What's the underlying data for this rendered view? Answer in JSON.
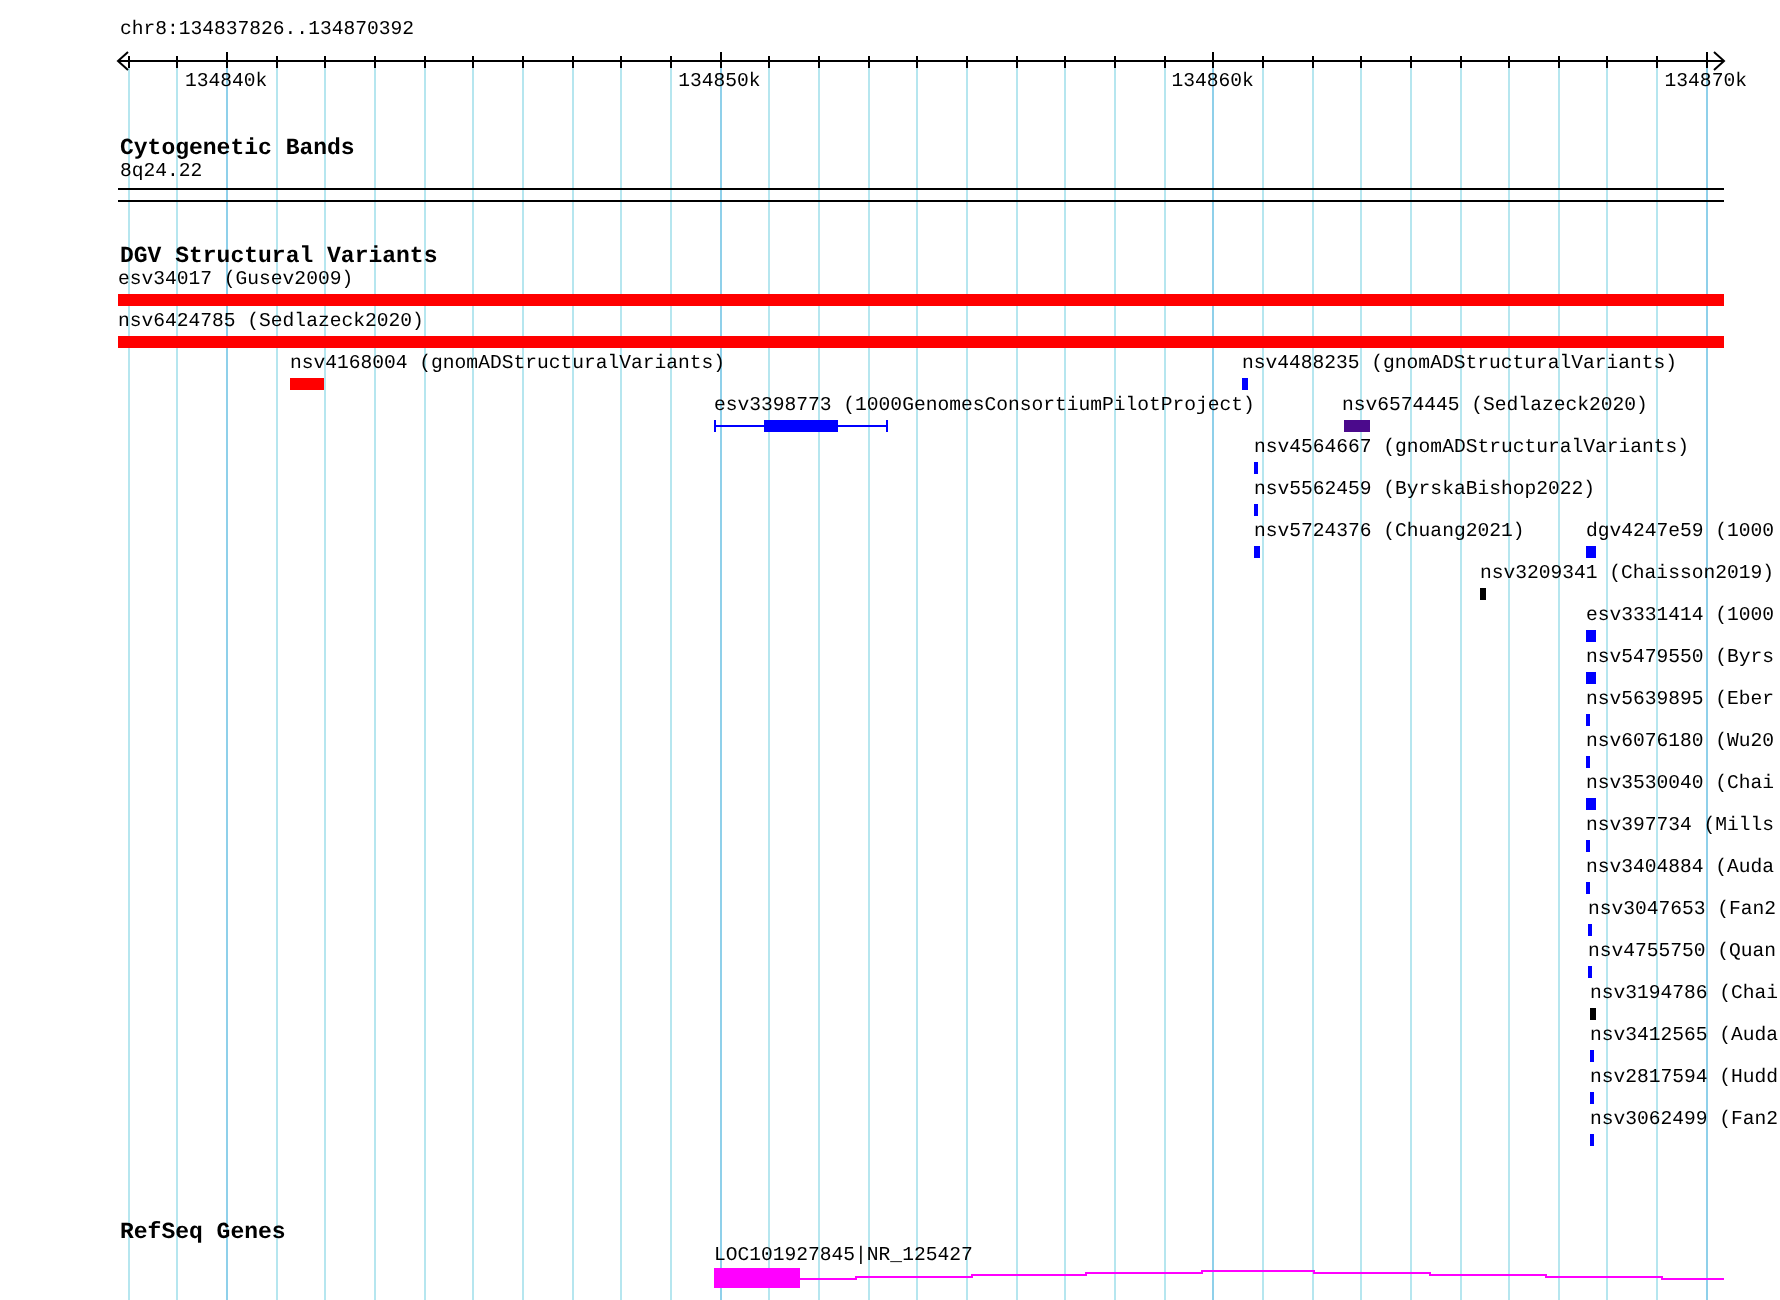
{
  "ruler": {
    "title": "chr8:134837826..134870392",
    "ticks": [
      "134840k",
      "134850k",
      "134860k",
      "134870k"
    ]
  },
  "tracks": [
    {
      "title": "Cytogenetic Bands",
      "kind": "cytoband",
      "features": [
        {
          "label": "8q24.22"
        }
      ]
    },
    {
      "title": "DGV Structural Variants",
      "kind": "variants",
      "features": [
        {
          "label": "esv34017 (Gusev2009)",
          "color": "#ff0000",
          "kind": "box"
        },
        {
          "label": "nsv6424785 (Sedlazeck2020)",
          "color": "#ff0000",
          "kind": "box"
        },
        {
          "label": "nsv4168004 (gnomADStructuralVariants)",
          "color": "#ff0000",
          "kind": "box"
        },
        {
          "label": "nsv4488235 (gnomADStructuralVariants)",
          "color": "#0000ff",
          "kind": "box"
        },
        {
          "label": "esv3398773 (1000GenomesConsortiumPilotProject)",
          "color": "#0000ff",
          "kind": "gapped"
        },
        {
          "label": "nsv6574445 (Sedlazeck2020)",
          "color": "#4b0a8c",
          "kind": "box"
        },
        {
          "label": "nsv4564667 (gnomADStructuralVariants)",
          "color": "#0000ff",
          "kind": "box"
        },
        {
          "label": "nsv5562459 (ByrskaBishop2022)",
          "color": "#0000ff",
          "kind": "box"
        },
        {
          "label": "nsv5724376 (Chuang2021)",
          "color": "#0000ff",
          "kind": "box"
        },
        {
          "label": "dgv4247e59 (1000",
          "color": "#0000ff",
          "kind": "box"
        },
        {
          "label": "nsv3209341 (Chaisson2019)",
          "color": "#000000",
          "kind": "box"
        },
        {
          "label": "esv3331414 (1000",
          "color": "#0000ff",
          "kind": "box"
        },
        {
          "label": "nsv5479550 (Byrs",
          "color": "#0000ff",
          "kind": "box"
        },
        {
          "label": "nsv5639895 (Eber",
          "color": "#0000ff",
          "kind": "box"
        },
        {
          "label": "nsv6076180 (Wu20",
          "color": "#0000ff",
          "kind": "box"
        },
        {
          "label": "nsv3530040 (Chai",
          "color": "#0000ff",
          "kind": "box"
        },
        {
          "label": "nsv397734 (Mills",
          "color": "#0000ff",
          "kind": "box"
        },
        {
          "label": "nsv3404884 (Auda",
          "color": "#0000ff",
          "kind": "box"
        },
        {
          "label": "nsv3047653 (Fan2",
          "color": "#0000ff",
          "kind": "box"
        },
        {
          "label": "nsv4755750 (Quan",
          "color": "#0000ff",
          "kind": "box"
        },
        {
          "label": "nsv3194786 (Chai",
          "color": "#000000",
          "kind": "box"
        },
        {
          "label": "nsv3412565 (Auda",
          "color": "#0000ff",
          "kind": "box"
        },
        {
          "label": "nsv2817594 (Hudd",
          "color": "#0000ff",
          "kind": "box"
        },
        {
          "label": "nsv3062499 (Fan2",
          "color": "#0000ff",
          "kind": "box"
        }
      ]
    },
    {
      "title": "RefSeq Genes",
      "kind": "gene",
      "features": [
        {
          "label": "LOC101927845|NR_125427",
          "color": "#ff00ff"
        }
      ]
    }
  ]
}
